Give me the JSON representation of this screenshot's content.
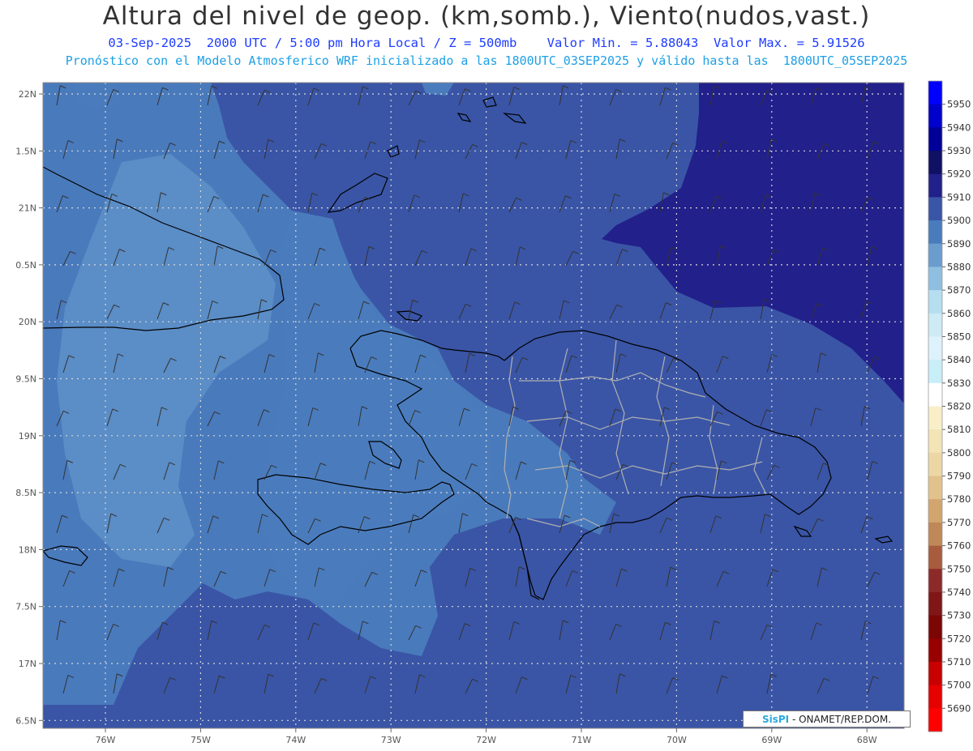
{
  "header": {
    "title": "Altura del nivel de geop. (km,somb.), Viento(nudos,vast.)",
    "line1": "03-Sep-2025  2000 UTC / 5:00 pm Hora Local / Z = 500mb    Valor Min. = 5.88043  Valor Max. = 5.91526",
    "line2": "Pronóstico con el Modelo Atmosferico WRF inicializado a las 1800UTC_03SEP2025 y válido hasta las  1800UTC_05SEP2025"
  },
  "axes": {
    "lat_labels": [
      "22N",
      "1.5N",
      "21N",
      "0.5N",
      "20N",
      "9.5N",
      "19N",
      "8.5N",
      "18N",
      "7.5N",
      "17N",
      "6.5N"
    ],
    "lon_labels": [
      "76W",
      "75W",
      "74W",
      "73W",
      "72W",
      "71W",
      "70W",
      "69W",
      "68W"
    ]
  },
  "colorbar": {
    "levels": [
      "5950",
      "5940",
      "5930",
      "5920",
      "5910",
      "5900",
      "5890",
      "5880",
      "5870",
      "5860",
      "5850",
      "5840",
      "5830",
      "5820",
      "5810",
      "5800",
      "5790",
      "5780",
      "5770",
      "5760",
      "5750",
      "5740",
      "5730",
      "5720",
      "5710",
      "5700",
      "5690"
    ],
    "colors": [
      "#0000ff",
      "#0000cc",
      "#000099",
      "#101065",
      "#22208a",
      "#3a55a6",
      "#4a7cbd",
      "#6a9dce",
      "#8fbfe0",
      "#b5def0",
      "#cdeaf5",
      "#ddf2fa",
      "#c8eef8",
      "#ffffff",
      "#f8efc8",
      "#f3e4b6",
      "#ecd7a4",
      "#e2c28c",
      "#d2a56f",
      "#bf8858",
      "#a85c3e",
      "#8c2a2a",
      "#801616",
      "#7a0606",
      "#990000",
      "#c80000",
      "#e60000",
      "#ff0000"
    ]
  },
  "credit": {
    "logo": "SisPI",
    "text": " - ONAMET/REP.DOM."
  },
  "colors": {
    "field_base": "#3a55a6",
    "field_high": "#22208a",
    "field_low": "#4a7cbd",
    "field_lower": "#6a9dce",
    "coast": "#000000",
    "provinces": "#b0b0b0"
  }
}
